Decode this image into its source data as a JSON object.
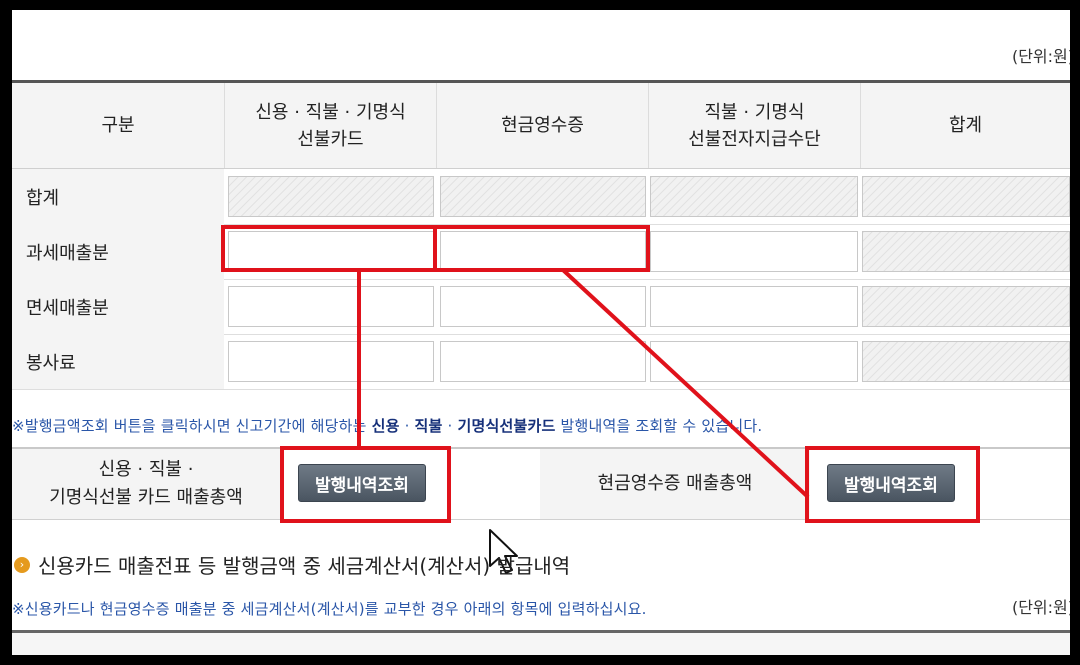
{
  "units": {
    "top": "(단위:원)",
    "bottom": "(단위:원)"
  },
  "table": {
    "headers": [
      "구분",
      "신용 · 직불 · 기명식\n선불카드",
      "현금영수증",
      "직불 · 기명식\n선불전자지급수단",
      "합계"
    ],
    "rows": [
      {
        "label": "합계",
        "cells": [
          "disabled",
          "disabled",
          "disabled",
          "disabled"
        ]
      },
      {
        "label": "과세매출분",
        "cells": [
          "input",
          "input",
          "input",
          "disabled"
        ]
      },
      {
        "label": "면세매출분",
        "cells": [
          "input",
          "input",
          "input",
          "disabled"
        ]
      },
      {
        "label": "봉사료",
        "cells": [
          "input",
          "input",
          "input",
          "disabled"
        ]
      }
    ]
  },
  "note1": {
    "prefix": "※발행금액조회 버튼을 클릭하시면 신고기간에 해당하는 ",
    "bold1": "신용",
    "sep1": " · ",
    "bold2": "직불",
    "sep2": " · ",
    "bold3": "기명식선불카드",
    "suffix": " 발행내역을 조회할 수 있습니다."
  },
  "panel": {
    "card_label": "신용 · 직불 ·\n기명식선불 카드 매출총액",
    "card_button": "발행내역조회",
    "cash_label": "현금영수증 매출총액",
    "cash_button": "발행내역조회"
  },
  "section_title": "신용카드 매출전표 등 발행금액 중 세금계산서(계산서) 발급내역",
  "note2": "※신용카드나 현금영수증 매출분 중 세금계산서(계산서)를 교부한 경우 아래의 항목에 입력하십시요.",
  "colors": {
    "highlight": "#e0121b",
    "button": "#55606c",
    "note": "#2a56a8",
    "bullet": "#e59a1e"
  }
}
